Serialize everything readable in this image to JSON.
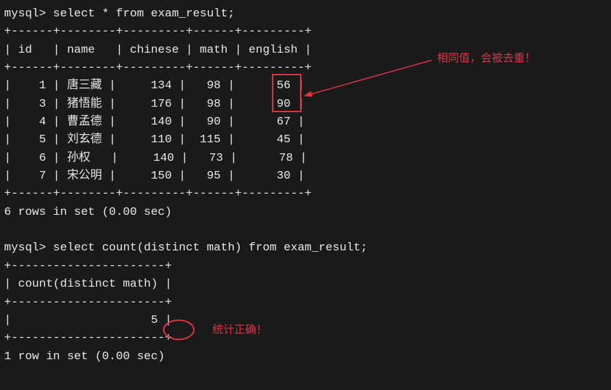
{
  "query1": {
    "prompt": "mysql> ",
    "sql": "select * from exam_result;",
    "border": "+------+--------+---------+------+---------+",
    "header": "| id   | name   | chinese | math | english |",
    "rows": [
      "|    1 | 唐三藏 |     134 |   98 |      56 |",
      "|    3 | 猪悟能 |     176 |   98 |      90 |",
      "|    4 | 曹孟德 |     140 |   90 |      67 |",
      "|    5 | 刘玄德 |     110 |  115 |      45 |",
      "|    6 | 孙权   |     140 |   73 |      78 |",
      "|    7 | 宋公明 |     150 |   95 |      30 |"
    ],
    "footer": "6 rows in set (0.00 sec)"
  },
  "query2": {
    "prompt": "mysql> ",
    "sql": "select count(distinct math) from exam_result;",
    "border": "+----------------------+",
    "header": "| count(distinct math) |",
    "row": "|                    5 |",
    "footer": "1 row in set (0.00 sec)"
  },
  "annotations": {
    "dedup": "相同值，会被去重！",
    "correct": "统计正确！"
  }
}
